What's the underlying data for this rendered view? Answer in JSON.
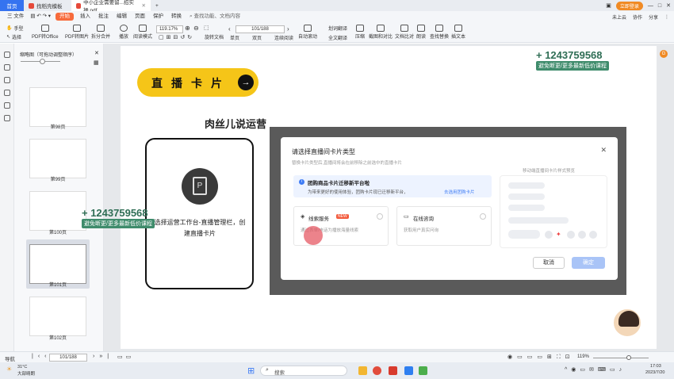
{
  "titlebar": {
    "home_tab": "首页",
    "tab1": "找稻壳模板",
    "tab2": "中小企业需要留...招实操.pdf",
    "new_tab": "+",
    "login": "立即登录"
  },
  "menubar": {
    "items": [
      "三 文件",
      "开始",
      "插入",
      "批注",
      "编辑",
      "页面",
      "保护",
      "转换"
    ],
    "search": "查找功能、文档内容",
    "right": [
      "未上云",
      "协作",
      "分享"
    ]
  },
  "toolbar": {
    "hand": "手型",
    "select": "选择",
    "pdf_to_office": "PDF转Office",
    "pdf_to_image": "PDF转图片",
    "split_merge": "拆分合并",
    "play": "播放",
    "read_mode": "阅读模式",
    "zoom": "119.17%",
    "page": "101/188",
    "rotate": "旋转文档",
    "single": "单页",
    "double": "双页",
    "continuous": "连续阅读",
    "auto_scroll": "自动滚动",
    "screen_translate": "划词翻译",
    "full_translate": "全文翻译",
    "compress": "压缩",
    "screenshot_compare": "截图和对比",
    "doc_compare": "文档比对",
    "read_aloud": "朗读",
    "find_replace": "查找替换",
    "insert_text": "插文本"
  },
  "sidebar": {
    "header": "缩略图（可拖动调整顺序）",
    "pages": [
      "第98页",
      "第99页",
      "第100页",
      "第101页",
      "第102页"
    ]
  },
  "slide": {
    "live_card": "直播卡片",
    "watermark_title": "肉丝儿说运营",
    "phone_text": "选择运营工作台-直播管理栏，创建直播卡片",
    "wm_number": "+ 1243759568",
    "wm_sub": "避免断更/更多最新低价课程"
  },
  "dialog": {
    "title": "请选择直播间卡片类型",
    "subtitle": "替换卡片类型后,直播间将会在前移除之前选中的直播卡片",
    "preview_label": "移动端直播间卡片样式预览",
    "info_title": "团购商品卡片迁移新平台啦",
    "info_text": "为带来更好的使用体验，团购卡片现已迁移新平台，",
    "info_link": "去选用团购卡片",
    "option1": "线索服务",
    "option1_badge": "NEW",
    "option1_desc": "通过表单/电话为播放海量线索",
    "option2": "在线咨询",
    "option2_desc": "获取用户真实问询",
    "cancel": "取消",
    "ok": "确定"
  },
  "statusbar": {
    "nav": "导航",
    "page": "101/188",
    "zoom": "119%"
  },
  "taskbar": {
    "weather_temp": "31°C",
    "weather_desc": "大部晴朗",
    "search": "搜索",
    "time": "17:03",
    "date": "2023/7/20"
  }
}
